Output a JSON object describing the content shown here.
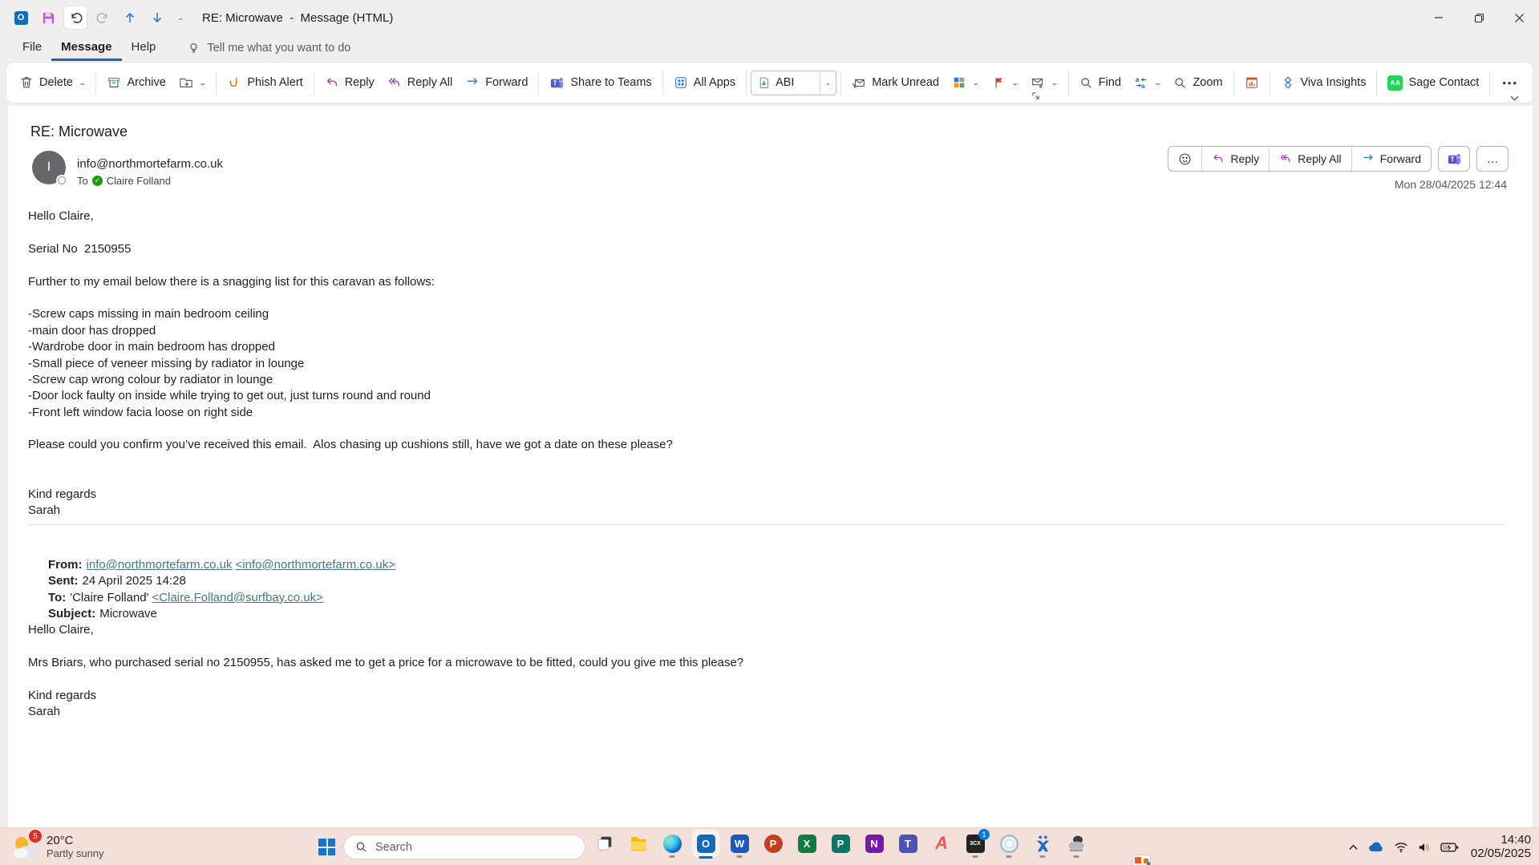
{
  "titlebar": {
    "title": "RE: Microwave  -  Message (HTML)"
  },
  "menubar": {
    "file": "File",
    "message": "Message",
    "help": "Help",
    "tellme": "Tell me what you want to do"
  },
  "ribbon": {
    "delete": "Delete",
    "archive": "Archive",
    "phish_alert": "Phish Alert",
    "reply": "Reply",
    "reply_all": "Reply All",
    "forward": "Forward",
    "share_to_teams": "Share to Teams",
    "all_apps": "All Apps",
    "quick_step": "ABI",
    "mark_unread": "Mark Unread",
    "find": "Find",
    "zoom": "Zoom",
    "viva_insights": "Viva Insights",
    "sage_contact": "Sage Contact",
    "more": "•••"
  },
  "message": {
    "subject": "RE: Microwave",
    "avatar_initial": "I",
    "sender_email": "info@northmortefarm.co.uk",
    "to_label": "To",
    "recipient": "Claire Folland",
    "sent_datetime": "Mon 28/04/2025 12:44",
    "actions": {
      "reply": "Reply",
      "reply_all": "Reply All",
      "forward": "Forward",
      "more": "…"
    },
    "body": {
      "greeting": "Hello Claire,",
      "serial": "Serial No  2150955",
      "intro": "Further to my email below there is a snagging list for this caravan as follows:",
      "snags": [
        "-Screw caps missing in main bedroom ceiling",
        "-main door has dropped",
        "-Wardrobe door in main bedroom has dropped",
        "-Small piece of veneer missing by radiator in lounge",
        "-Screw cap wrong colour by radiator in lounge",
        "-Door lock faulty on inside while trying to get out, just turns round and round",
        "-Front left window facia loose on right side"
      ],
      "confirm": "Please could you confirm you’ve received this email.  Alos chasing up cushions still, have we got a date on these please?",
      "signoff": "Kind regards",
      "signature": "Sarah"
    },
    "quote": {
      "from_label": "From:",
      "from_link": "info@northmortefarm.co.uk",
      "from_addr": "<info@northmortefarm.co.uk>",
      "sent_label": "Sent:",
      "sent_value": "24 April 2025 14:28",
      "to_label": "To:",
      "to_name": "'Claire Folland'",
      "to_addr": "<Claire.Folland@surfbay.co.uk>",
      "subject_label": "Subject:",
      "subject_value": "Microwave",
      "greeting": "Hello Claire,",
      "body_text": "Mrs Briars, who purchased serial no 2150955, has asked me to get a price for a microwave to be fitted, could you give me this please?",
      "signoff": "Kind regards",
      "signature": "Sarah"
    }
  },
  "icon_letters": {
    "qat_outlook": "O",
    "outlook": "O",
    "word": "W",
    "powerpoint": "P",
    "excel": "X",
    "publisher": "P",
    "onenote": "N",
    "teams": "T",
    "a_app": "A",
    "sage": "AA",
    "cx3": "3CX",
    "teams_ribbon": "T"
  },
  "taskbar": {
    "weather": {
      "temp": "20°C",
      "condition": "Partly sunny",
      "badge": "5"
    },
    "search": "Search",
    "badges": {
      "cx3": "1"
    },
    "clock": {
      "time": "14:40",
      "date": "02/05/2025"
    }
  }
}
